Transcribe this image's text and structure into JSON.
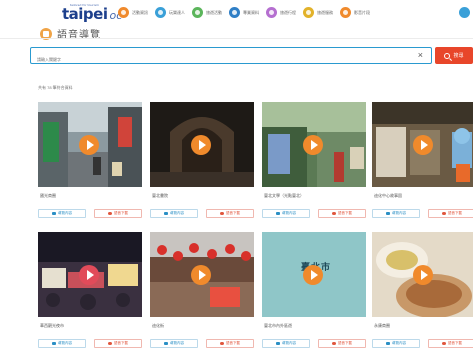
{
  "nav": {
    "logo_tiny": "tailored for tourism",
    "logo_main": "taipei",
    "logo_sub": "oc",
    "items": [
      {
        "label": "活動資訊",
        "color": "#f08a2c"
      },
      {
        "label": "玩樂達人",
        "color": "#3aa0d8"
      },
      {
        "label": "旅遊活動",
        "color": "#5bb55b"
      },
      {
        "label": "專業資料",
        "color": "#2f7fc6"
      },
      {
        "label": "旅遊行程",
        "color": "#b56fd0"
      },
      {
        "label": "旅遊服務",
        "color": "#e2b22a"
      },
      {
        "label": "影音片段",
        "color": "#f08a2c"
      }
    ]
  },
  "section": {
    "title": "語音導覽"
  },
  "search": {
    "placeholder": "請輸入關鍵字",
    "clear": "×",
    "button_label": "搜尋"
  },
  "result_count": "共有 78 筆符合資料",
  "buttons": {
    "view": "導覽內容",
    "download": "語音下載"
  },
  "cards": [
    {
      "title": "國光商圈"
    },
    {
      "title": "臺北書院"
    },
    {
      "title": "臺北文學（光點臺北）"
    },
    {
      "title": "迪化中心故事園"
    },
    {
      "title": "華西觀光夜市"
    },
    {
      "title": "迪化街"
    },
    {
      "title": "臺北市內外區遊"
    },
    {
      "title": "永康商圈"
    }
  ],
  "thumb_badge": {
    "line1": "臺北市",
    "line2": "taipei"
  },
  "colors": {
    "accent": "#e8462a",
    "brand": "#2a9ad0",
    "play": "#f08a2c"
  }
}
